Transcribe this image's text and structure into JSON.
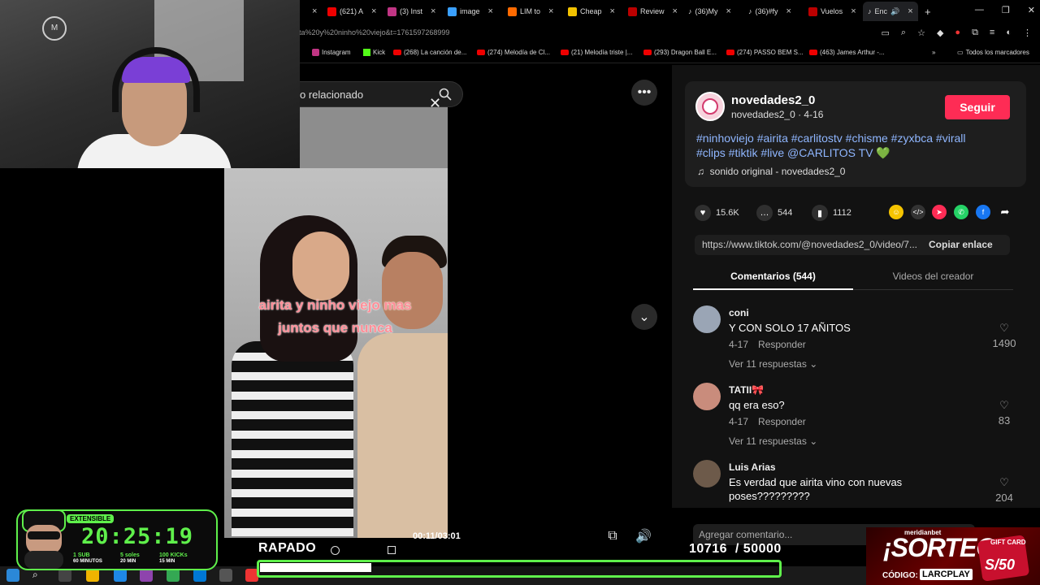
{
  "browser": {
    "tabs": [
      {
        "label": "(621) A",
        "color": "#e00"
      },
      {
        "label": "(3) Inst",
        "color": "#c13584"
      },
      {
        "label": "image",
        "color": "#3aa0ff"
      },
      {
        "label": "LIM to",
        "color": "#ff6a00"
      },
      {
        "label": "Cheap",
        "color": "#f2c200"
      },
      {
        "label": "Review",
        "color": "#b00"
      },
      {
        "label": "(36)My",
        "color": "#111"
      },
      {
        "label": "(36)#fy",
        "color": "#111"
      },
      {
        "label": "Vuelos",
        "color": "#b00"
      },
      {
        "label": "Enc",
        "color": "#111"
      }
    ],
    "url": "ita%20y%20ninho%20viejo&t=1761597268999",
    "bookmarks": [
      {
        "label": "Instagram"
      },
      {
        "label": "Kick"
      },
      {
        "label": "(268) La canción de..."
      },
      {
        "label": "(274) Melodía de Cl..."
      },
      {
        "label": "(21) Melodía triste |..."
      },
      {
        "label": "(293) Dragon Ball E..."
      },
      {
        "label": "(274) PASSO BEM S..."
      },
      {
        "label": "(463) James Arthur -..."
      }
    ],
    "bookmarks_all": "Todos los marcadores"
  },
  "search": {
    "text": "o relacionado"
  },
  "video": {
    "caption_line1": "airita y ninho viejo mas",
    "caption_line2": "juntos que nunca",
    "time": "00:11/03:01"
  },
  "author": {
    "name": "novedades2_0",
    "subtitle": "novedades2_0 · 4-16",
    "follow": "Seguir",
    "description": "#ninhoviejo #airita #carlitostv #chisme #zyxbca #virall #clips #tiktik #live @CARLITOS TV 💚",
    "music": "sonido original - novedades2_0"
  },
  "stats": {
    "likes": "15.6K",
    "comments": "544",
    "saves": "1112"
  },
  "link": {
    "url": "https://www.tiktok.com/@novedades2_0/video/7...",
    "copy": "Copiar enlace"
  },
  "tabs": {
    "comments": "Comentarios (544)",
    "videos": "Videos del creador"
  },
  "comments": [
    {
      "user": "coni",
      "text": "Y CON SOLO 17 AÑITOS",
      "date": "4-17",
      "reply": "Responder",
      "replies": "Ver 11 respuestas",
      "likes": "1490"
    },
    {
      "user": "TATII🎀",
      "text": "qq era eso?",
      "date": "4-17",
      "reply": "Responder",
      "replies": "Ver 11 respuestas",
      "likes": "83"
    },
    {
      "user": "Luis Arias",
      "text": "Es verdad que airita vino con nuevas poses?????????",
      "date": "",
      "reply": "",
      "replies": "",
      "likes": "204"
    }
  ],
  "add_comment": "Agregar comentario...",
  "overlay": {
    "timer_label": "EXTENSIBLE",
    "timer": "20:25:19",
    "rule1_a": "1 SUB",
    "rule1_b": "60 MINUTOS",
    "rule2_a": "5 soles",
    "rule2_b": "20 MIN",
    "rule3_a": "100 KICKs",
    "rule3_b": "15 MIN",
    "goal_title": "RAPADO",
    "goal_current": "10716",
    "goal_sep": "/",
    "goal_target": "50000",
    "goal_fraction": 0.214,
    "sorteo_brand": "meridianbet",
    "sorteo_title": "¡SORTEO!",
    "sorteo_code_label": "CÓDIGO:",
    "sorteo_code": "LARCPLAY",
    "gift_label": "GIFT CARD",
    "gift_amount": "S/50"
  },
  "colors": {
    "accent": "#fe2c55",
    "hashtag": "#8fb6ff",
    "overlay_green": "#5ff04b"
  }
}
